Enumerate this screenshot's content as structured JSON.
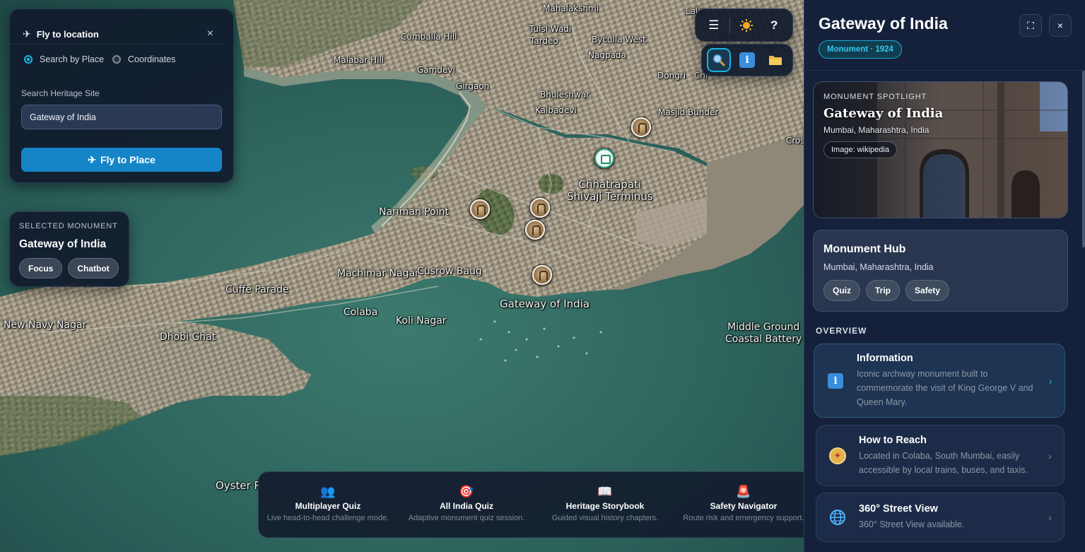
{
  "map": {
    "labels": [
      {
        "id": "mahalakshmi",
        "text": "Mahalakshmi"
      },
      {
        "id": "lalbaug",
        "text": "Lalb"
      },
      {
        "id": "cumballa",
        "text": "Cumballa Hill"
      },
      {
        "id": "tulsiwadi",
        "text": "Tulsi Wadi"
      },
      {
        "id": "tardeo",
        "text": "Tardeo"
      },
      {
        "id": "byculla",
        "text": "Byculla West"
      },
      {
        "id": "malabar",
        "text": "Malabar Hill"
      },
      {
        "id": "nagpada",
        "text": "Nagpada"
      },
      {
        "id": "gamdevi",
        "text": "Gamdevi"
      },
      {
        "id": "dongri",
        "text": "Dongri"
      },
      {
        "id": "chi",
        "text": "Chi"
      },
      {
        "id": "girgaon",
        "text": "Girgaon"
      },
      {
        "id": "bhuleshwar",
        "text": "Bhuleshwar"
      },
      {
        "id": "kalbadevi",
        "text": "Kalbadevi"
      },
      {
        "id": "masjid",
        "text": "Masjid Bunder"
      },
      {
        "id": "cross",
        "text": "Cros"
      },
      {
        "id": "nariman",
        "text": "Nariman Point"
      },
      {
        "id": "machimar",
        "text": "Machimar Nagar"
      },
      {
        "id": "cusrow",
        "text": "Cusrow Baug"
      },
      {
        "id": "cuffe",
        "text": "Cuffe Parade"
      },
      {
        "id": "colaba",
        "text": "Colaba"
      },
      {
        "id": "koli",
        "text": "Koli Nagar"
      },
      {
        "id": "newnavy",
        "text": "New Navy Nagar"
      },
      {
        "id": "dhobi",
        "text": "Dhobi Ghat"
      },
      {
        "id": "oyster",
        "text": "Oyster R"
      }
    ],
    "csmt_label": "Chhatrapati\nShivaji Terminus",
    "csmt_line1": "Chhatrapati",
    "csmt_line2": "Shivaji Terminus",
    "gateway_label": "Gateway of India",
    "middle_ground_line1": "Middle Ground",
    "middle_ground_line2": "Coastal Battery"
  },
  "fly_panel": {
    "title": "Fly to location",
    "close": "×",
    "radio_place": "Search by Place",
    "radio_coords": "Coordinates",
    "search_label": "Search Heritage Site",
    "search_value": "Gateway of India",
    "button": "Fly to Place"
  },
  "selected": {
    "caption": "SELECTED MONUMENT",
    "name": "Gateway of India",
    "focus": "Focus",
    "chatbot": "Chatbot"
  },
  "toolbar": {
    "menu": "☰",
    "sun": "☀",
    "help": "?",
    "info": "i"
  },
  "dock": [
    {
      "id": "multiplayer",
      "icon": "👥",
      "title": "Multiplayer Quiz",
      "sub": "Live head-to-head challenge mode."
    },
    {
      "id": "allindia",
      "icon": "🎯",
      "title": "All India Quiz",
      "sub": "Adaptive monument quiz session."
    },
    {
      "id": "storybook",
      "icon": "📖",
      "title": "Heritage Storybook",
      "sub": "Guided visual history chapters."
    },
    {
      "id": "safety",
      "icon": "🚨",
      "title": "Safety Navigator",
      "sub": "Route risk and emergency support."
    }
  ],
  "sidebar": {
    "title": "Gateway of India",
    "tag": "Monument · 1924",
    "expand": "⛶",
    "close": "×",
    "spotlight": {
      "caption": "MONUMENT SPOTLIGHT",
      "title": "Gateway of India",
      "location": "Mumbai, Maharashtra, India",
      "credit": "Image: wikipedia"
    },
    "hub": {
      "title": "Monument Hub",
      "location": "Mumbai, Maharashtra, India",
      "quiz": "Quiz",
      "trip": "Trip",
      "safety": "Safety"
    },
    "overview_caption": "OVERVIEW",
    "cards": [
      {
        "id": "information",
        "title": "Information",
        "desc": "Iconic archway monument built to commemorate the visit of King George V and Queen Mary."
      },
      {
        "id": "reach",
        "title": "How to Reach",
        "desc": "Located in Colaba, South Mumbai, easily accessible by local trains, buses, and taxis."
      },
      {
        "id": "streetview",
        "title": "360° Street View",
        "desc": "360° Street View available."
      }
    ],
    "chevron": "›"
  },
  "colors": {
    "accent": "#19b3e6",
    "button_blue": "#1585c8",
    "sidebar_bg": "#15213a",
    "water": "#2f6b62"
  }
}
